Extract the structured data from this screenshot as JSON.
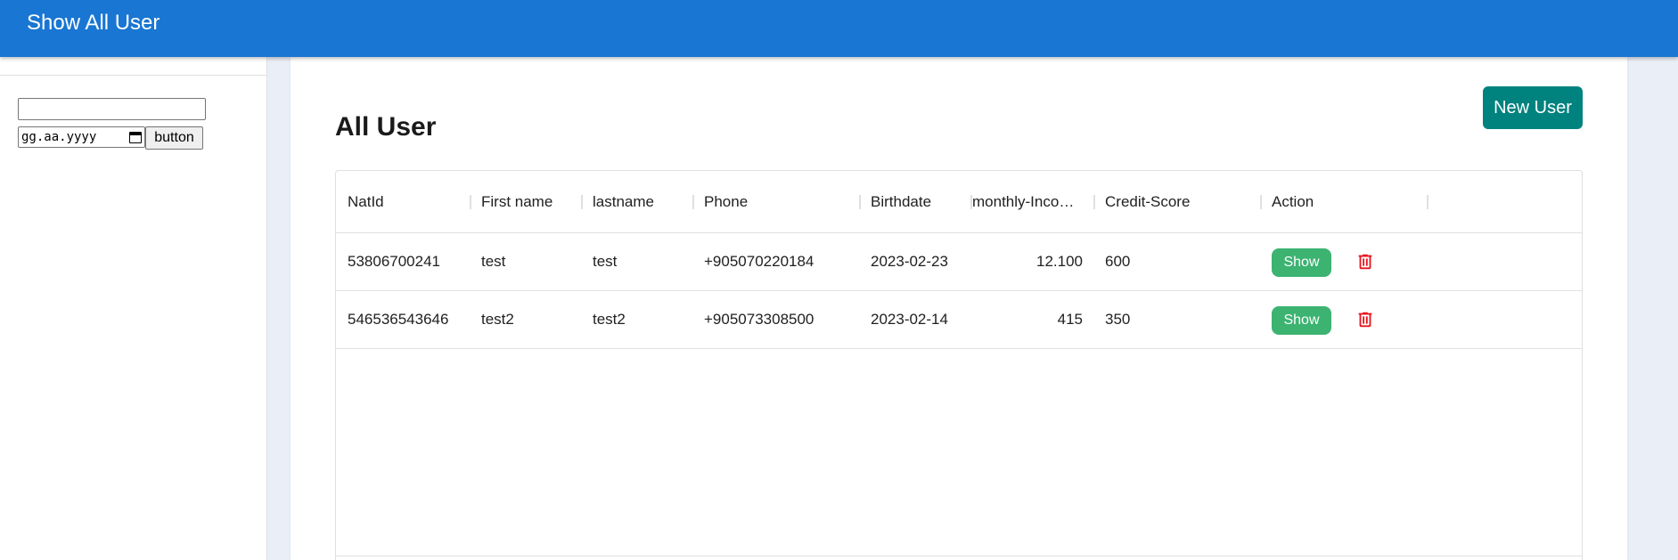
{
  "appbar": {
    "title": "Show All User"
  },
  "sidebar": {
    "text_input": {
      "value": ""
    },
    "date_input": {
      "placeholder": "gg.aa.yyyy"
    },
    "button_label": "button"
  },
  "main": {
    "title": "All User",
    "new_user_label": "New User"
  },
  "table": {
    "columns": [
      "NatId",
      "First name",
      "lastname",
      "Phone",
      "Birthdate",
      "monthly-Inco…",
      "Credit-Score",
      "Action"
    ],
    "rows": [
      {
        "natid": "53806700241",
        "first_name": "test",
        "lastname": "test",
        "phone": "+905070220184",
        "birthdate": "2023-02-23",
        "monthly_income": "12.100",
        "credit_score": "600",
        "show_label": "Show"
      },
      {
        "natid": "546536543646",
        "first_name": "test2",
        "lastname": "test2",
        "phone": "+905073308500",
        "birthdate": "2023-02-14",
        "monthly_income": "415",
        "credit_score": "350",
        "show_label": "Show"
      }
    ]
  },
  "colors": {
    "appbar": "#1976d2",
    "new_user_button": "#00827f",
    "show_button": "#3cb371",
    "delete_icon": "#e8141e"
  },
  "icons": [
    "calendar-icon",
    "trash-icon"
  ]
}
